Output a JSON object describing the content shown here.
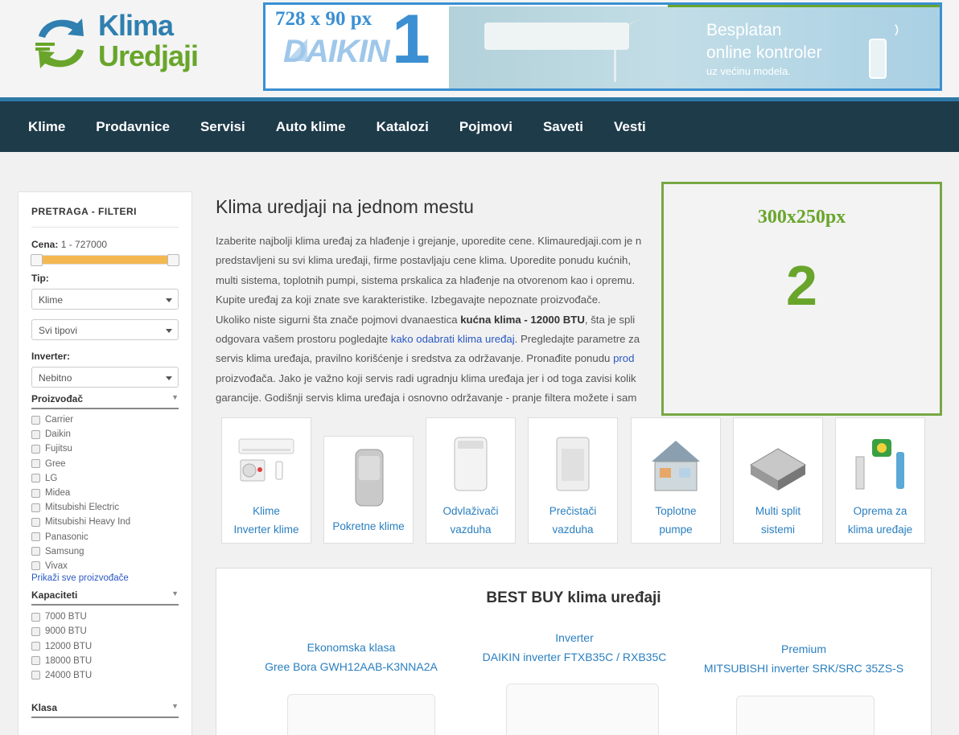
{
  "logo": {
    "line1": "Klima",
    "line2": "Uredjaji"
  },
  "ad_top": {
    "size": "728 x 90 px",
    "number": "1",
    "brand": "DAIKIN",
    "headline1": "Besplatan",
    "headline2": "online kontroler",
    "subline": "uz većinu modela."
  },
  "nav": {
    "items": [
      "Klime",
      "Prodavnice",
      "Servisi",
      "Auto klime",
      "Katalozi",
      "Pojmovi",
      "Saveti",
      "Vesti"
    ]
  },
  "sidebar": {
    "title": "PRETRAGA - FILTERI",
    "price_label": "Cena:",
    "price_range": "1 - 727000",
    "price_slider": {
      "min": 1,
      "max": 727000,
      "low": 1,
      "high": 727000
    },
    "type_label": "Tip:",
    "type_select": "Klime",
    "subtype_select": "Svi tipovi",
    "inverter_label": "Inverter:",
    "inverter_select": "Nebitno",
    "manufacturer_label": "Proizvođač",
    "manufacturers": [
      "Carrier",
      "Daikin",
      "Fujitsu",
      "Gree",
      "LG",
      "Midea",
      "Mitsubishi Electric",
      "Mitsubishi Heavy Ind",
      "Panasonic",
      "Samsung",
      "Vivax"
    ],
    "show_all": "Prikaži sve proizvođače",
    "capacity_label": "Kapaciteti",
    "capacities": [
      "7000 BTU",
      "9000 BTU",
      "12000 BTU",
      "18000 BTU",
      "24000 BTU"
    ],
    "class_label": "Klasa"
  },
  "main": {
    "title": "Klima uredjaji na jednom mestu",
    "intro": {
      "l1": "Izaberite najbolji klima uređaj za hlađenje i grejanje, uporedite cene. Klimauredjaji.com je n",
      "l2": "predstavljeni su svi klima uređaji, firme postavljaju cene klima. Uporedite ponudu kućnih,",
      "l3": "multi sistema, toplotnih pumpi, sistema prskalica za hlađenje na otvorenom kao i opremu.",
      "l4": "Kupite uređaj za koji znate sve karakteristike. Izbegavajte nepoznate proizvođače.",
      "l5a": "Ukoliko niste sigurni šta znače pojmovi dvanaestica ",
      "l5b": "kućna klima - 12000 BTU",
      "l5c": ", šta je spli",
      "l6a": "odgovara vašem prostoru pogledajte ",
      "l6b": "kako odabrati klima uređaj",
      "l6c": ". Pregledajte parametre za",
      "l7a": "servis klima uređaja, pravilno korišćenje i sredstva za održavanje. Pronađite ponudu ",
      "l7b": "prod",
      "l8": "proizvođača. Jako je važno koji servis radi ugradnju klima uređaja jer i od toga zavisi kolik",
      "l9": "garancije. Godišnji servis klima uređaja i osnovno održavanje - pranje filtera možete i sam"
    }
  },
  "ad_side": {
    "size": "300x250px",
    "number": "2"
  },
  "categories": [
    {
      "l1": "Klime",
      "l2": "Inverter klime"
    },
    {
      "l1": "",
      "l2": "Pokretne klime"
    },
    {
      "l1": "Odvlaživači",
      "l2": "vazduha"
    },
    {
      "l1": "Prečistači",
      "l2": "vazduha"
    },
    {
      "l1": "Toplotne",
      "l2": "pumpe"
    },
    {
      "l1": "Multi split",
      "l2": "sistemi"
    },
    {
      "l1": "Oprema za",
      "l2": "klima uređaje"
    }
  ],
  "bestbuy": {
    "title": "BEST BUY klima uređaji",
    "products": [
      {
        "category": "Ekonomska klasa",
        "name": "Gree Bora GWH12AAB-K3NNA2A"
      },
      {
        "category": "Inverter",
        "name": "DAIKIN inverter FTXB35C / RXB35C"
      },
      {
        "category": "Premium",
        "name": "MITSUBISHI inverter SRK/SRC 35ZS-S"
      }
    ]
  },
  "colors": {
    "nav_bg": "#1e3b4a",
    "nav_border": "#2d7aa8",
    "accent_blue": "#3b8fd2",
    "accent_green": "#69a52b",
    "link": "#2a7fc0",
    "slider": "#f5b850"
  }
}
